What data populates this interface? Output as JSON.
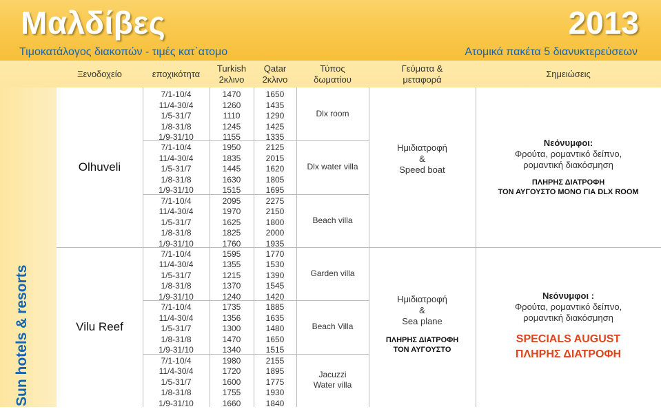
{
  "header": {
    "title": "Μαλδίβες",
    "year": "2013",
    "subtitle_left": "Τιμοκατάλογος διακοπών  - τιμές κατ΄ατομο",
    "subtitle_right": "Ατομικά πακέτα 5 διανυκτερεύσεων"
  },
  "columns": {
    "hotel": "Ξενοδοχείο",
    "season": "εποχικότητα",
    "turkish": "Turkish\n2κλινο",
    "qatar": "Qatar\n2κλινο",
    "room": "Τύπος\nδωματίου",
    "meals": "Γεύματα &\nμεταφορά",
    "notes": "Σημειώσεις"
  },
  "sidebar_label": "Sun hotels & resorts",
  "hotels": [
    {
      "name": "Olhuveli",
      "meals": [
        "Ημιδιατροφή",
        "&",
        "Speed boat"
      ],
      "notes_title": "Νεόνυμφοι:",
      "notes_lines": [
        "Φρούτα, ρομαντικό δείπνο,",
        "ρομαντική διακόσμηση"
      ],
      "notes_extra": [
        "ΠΛΗΡΗΣ ΔΙΑΤΡΟΦΗ",
        "ΤΟΝ ΑΥΓΟΥΣΤΟ ΜΟΝΟ ΓΙΑ DLX ROOM"
      ],
      "rooms": [
        {
          "type": "Dlx room",
          "seasons": [
            "7/1-10/4",
            "11/4-30/4",
            "1/5-31/7",
            "1/8-31/8",
            "1/9-31/10"
          ],
          "turkish": [
            "1470",
            "1260",
            "1110",
            "1245",
            "1155"
          ],
          "qatar": [
            "1650",
            "1435",
            "1290",
            "1425",
            "1335"
          ]
        },
        {
          "type": "Dlx water villa",
          "seasons": [
            "7/1-10/4",
            "11/4-30/4",
            "1/5-31/7",
            "1/8-31/8",
            "1/9-31/10"
          ],
          "turkish": [
            "1950",
            "1835",
            "1445",
            "1630",
            "1515"
          ],
          "qatar": [
            "2125",
            "2015",
            "1620",
            "1805",
            "1695"
          ]
        },
        {
          "type": "Beach villa",
          "seasons": [
            "7/1-10/4",
            "11/4-30/4",
            "1/5-31/7",
            "1/8-31/8",
            "1/9-31/10"
          ],
          "turkish": [
            "2095",
            "1970",
            "1625",
            "1825",
            "1760"
          ],
          "qatar": [
            "2275",
            "2150",
            "1800",
            "2000",
            "1935"
          ]
        }
      ]
    },
    {
      "name": "Vilu Reef",
      "meals": [
        "Ημιδιατροφή",
        "&",
        "Sea plane"
      ],
      "meals_extra": [
        "ΠΛΗΡΗΣ ΔΙΑΤΡΟΦΗ",
        "ΤΟΝ ΑΥΓΟΥΣΤΟ"
      ],
      "notes_title": "Νεόνυμφοι :",
      "notes_lines": [
        "Φρούτα, ρομαντικό δείπνο,",
        "ρομαντική διακόσμηση"
      ],
      "specials": [
        "SPECIALS AUGUST",
        "ΠΛΗΡΗΣ ΔΙΑΤΡΟΦΗ"
      ],
      "rooms": [
        {
          "type": "Garden  villa",
          "seasons": [
            "7/1-10/4",
            "11/4-30/4",
            "1/5-31/7",
            "1/8-31/8",
            "1/9-31/10"
          ],
          "turkish": [
            "1595",
            "1355",
            "1215",
            "1370",
            "1240"
          ],
          "qatar": [
            "1770",
            "1530",
            "1390",
            "1545",
            "1420"
          ]
        },
        {
          "type": "Beach  Villa",
          "seasons": [
            "7/1-10/4",
            "11/4-30/4",
            "1/5-31/7",
            "1/8-31/8",
            "1/9-31/10"
          ],
          "turkish": [
            "1735",
            "1356",
            "1300",
            "1470",
            "1340"
          ],
          "qatar": [
            "1885",
            "1635",
            "1480",
            "1650",
            "1515"
          ]
        },
        {
          "type": "Jacuzzi\nWater villa",
          "seasons": [
            "7/1-10/4",
            "11/4-30/4",
            "1/5-31/7",
            "1/8-31/8",
            "1/9-31/10"
          ],
          "turkish": [
            "1980",
            "1720",
            "1600",
            "1755",
            "1660"
          ],
          "qatar": [
            "2155",
            "1895",
            "1775",
            "1930",
            "1840"
          ]
        }
      ]
    }
  ]
}
